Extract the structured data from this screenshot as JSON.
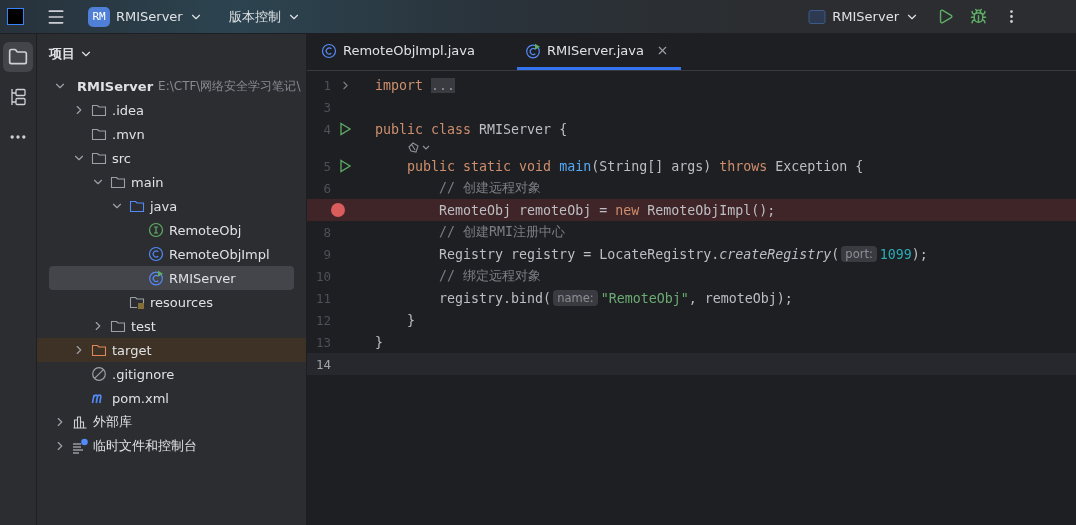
{
  "top_bar": {
    "project_badge": "RM",
    "project": "RMIServer",
    "vcs": "版本控制",
    "run_config": "RMIServer"
  },
  "tool_strip": [
    {
      "kind": "folder",
      "selected": true
    },
    {
      "kind": "structure",
      "selected": false
    },
    {
      "kind": "more",
      "selected": false
    }
  ],
  "project_panel": {
    "title": "项目",
    "tree": [
      {
        "label": "RMIServer",
        "path": "E:\\CTF\\网络安全学习笔记\\",
        "kind": "module",
        "expanded": true,
        "selected": false,
        "children": [
          {
            "label": ".idea",
            "kind": "folder",
            "expanded": false,
            "selected": false
          },
          {
            "label": ".mvn",
            "kind": "folder",
            "selected": false
          },
          {
            "label": "src",
            "kind": "folder",
            "expanded": true,
            "selected": false,
            "children": [
              {
                "label": "main",
                "kind": "folder",
                "expanded": true,
                "selected": false,
                "children": [
                  {
                    "label": "java",
                    "kind": "source",
                    "expanded": true,
                    "selected": false,
                    "children": [
                      {
                        "label": "RemoteObj",
                        "kind": "interface",
                        "selected": false
                      },
                      {
                        "label": "RemoteObjImpl",
                        "kind": "class",
                        "selected": false
                      },
                      {
                        "label": "RMIServer",
                        "kind": "runnable",
                        "selected": true
                      }
                    ]
                  },
                  {
                    "label": "resources",
                    "kind": "resources",
                    "selected": false
                  }
                ]
              },
              {
                "label": "test",
                "kind": "folder",
                "expanded": false,
                "selected": false
              }
            ]
          },
          {
            "label": "target",
            "kind": "excluded",
            "expanded": false,
            "selected": false
          },
          {
            "label": ".gitignore",
            "kind": "ignore",
            "selected": false
          },
          {
            "label": "pom.xml",
            "kind": "maven",
            "selected": false
          }
        ]
      },
      {
        "label": "外部库",
        "kind": "library",
        "expanded": false,
        "selected": false
      },
      {
        "label": "临时文件和控制台",
        "kind": "scratches",
        "expanded": false,
        "selected": false
      }
    ]
  },
  "tabs": [
    {
      "label": "RemoteObjImpl.java",
      "kind": "class",
      "selected": false
    },
    {
      "label": "RMIServer.java",
      "kind": "runnable",
      "selected": true
    }
  ],
  "code_lines": [
    {
      "n": "1",
      "kind": "fold",
      "current": false,
      "tokens": [
        {
          "kind": "kw",
          "t": "import "
        },
        {
          "kind": "folded",
          "t": "..."
        }
      ]
    },
    {
      "n": "3",
      "kind": "plain",
      "current": false
    },
    {
      "n": "4",
      "kind": "run",
      "current": false,
      "tokens": [
        {
          "kind": "kw",
          "t": "public class "
        },
        {
          "kind": "p",
          "t": "RMIServer {"
        }
      ]
    },
    {
      "kind": "inlay",
      "current": false
    },
    {
      "n": "5",
      "kind": "run",
      "current": false,
      "tokens": [
        {
          "kind": "kw",
          "t": "    public static void "
        },
        {
          "kind": "fn",
          "t": "main"
        },
        {
          "kind": "p",
          "t": "(String[] args) "
        },
        {
          "kind": "kw",
          "t": "throws "
        },
        {
          "kind": "p",
          "t": "Exception {"
        }
      ]
    },
    {
      "n": "6",
      "kind": "plain",
      "current": false,
      "tokens": [
        {
          "kind": "comment",
          "t": "        // 创建远程对象"
        }
      ]
    },
    {
      "kind": "breakpoint",
      "current": false,
      "tokens": [
        {
          "kind": "p",
          "t": "        RemoteObj remoteObj = "
        },
        {
          "kind": "kw",
          "t": "new "
        },
        {
          "kind": "p",
          "t": "RemoteObjImpl();"
        }
      ]
    },
    {
      "n": "8",
      "kind": "plain",
      "current": false,
      "tokens": [
        {
          "kind": "comment",
          "t": "        // 创建RMI注册中心"
        }
      ]
    },
    {
      "n": "9",
      "kind": "plain",
      "current": false,
      "tokens": [
        {
          "kind": "p",
          "t": "        Registry registry = LocateRegistry."
        },
        {
          "kind": "italic",
          "t": "createRegistry"
        },
        {
          "kind": "p",
          "t": "("
        },
        {
          "kind": "hint",
          "t": "port:"
        },
        {
          "kind": "num",
          "t": "1099"
        },
        {
          "kind": "p",
          "t": ");"
        }
      ]
    },
    {
      "n": "10",
      "kind": "plain",
      "current": false,
      "tokens": [
        {
          "kind": "comment",
          "t": "        // 绑定远程对象"
        }
      ]
    },
    {
      "n": "11",
      "kind": "plain",
      "current": false,
      "tokens": [
        {
          "kind": "p",
          "t": "        registry.bind("
        },
        {
          "kind": "hint",
          "t": "name:"
        },
        {
          "kind": "str",
          "t": "\"RemoteObj\""
        },
        {
          "kind": "p",
          "t": ", remoteObj);"
        }
      ]
    },
    {
      "n": "12",
      "kind": "plain",
      "current": false,
      "tokens": [
        {
          "kind": "p",
          "t": "    }"
        }
      ]
    },
    {
      "n": "13",
      "kind": "plain",
      "current": false,
      "tokens": [
        {
          "kind": "p",
          "t": "}"
        }
      ]
    },
    {
      "n": "14",
      "kind": "plain",
      "current": true
    }
  ]
}
